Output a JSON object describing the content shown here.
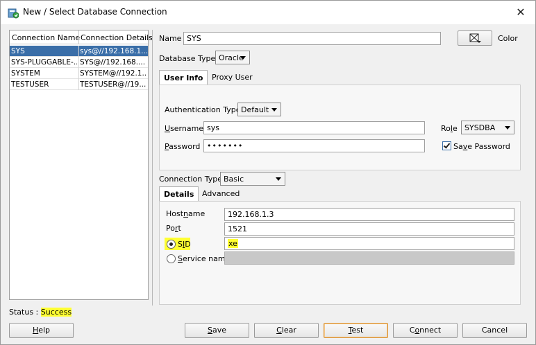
{
  "window": {
    "title": "New / Select Database Connection",
    "close_glyph": "✕"
  },
  "connections": {
    "columns": [
      "Connection Name",
      "Connection Details"
    ],
    "rows": [
      {
        "name": "SYS",
        "details": "sys@//192.168.1...",
        "selected": true
      },
      {
        "name": "SYS-PLUGGABLE-...",
        "details": "SYS@//192.168....",
        "selected": false
      },
      {
        "name": "SYSTEM",
        "details": "SYSTEM@//192.1...",
        "selected": false
      },
      {
        "name": "TESTUSER",
        "details": "TESTUSER@//19...",
        "selected": false
      }
    ]
  },
  "form": {
    "name_label": "Name",
    "name_value": "SYS",
    "color_label": "Color",
    "db_type_label": "Database Type",
    "db_type_value": "Oracle",
    "tabs": [
      "User Info",
      "Proxy User"
    ],
    "auth_type_label": "Authentication Type",
    "auth_type_value": "Default",
    "username_label_pre": "",
    "username_label_u": "U",
    "username_label_post": "sername",
    "username_value": "sys",
    "role_label_pre": "Ro",
    "role_label_u": "l",
    "role_label_post": "e",
    "role_value": "SYSDBA",
    "password_label_pre": "",
    "password_label_u": "P",
    "password_label_post": "assword",
    "password_value": "•••••••",
    "save_password_label_pre": "Sa",
    "save_password_label_u": "v",
    "save_password_label_post": "e Password",
    "save_password_checked": true,
    "conn_type_label": "Connection Type",
    "conn_type_value": "Basic",
    "detail_tabs": [
      "Details",
      "Advanced"
    ],
    "hostname_label_pre": "Host",
    "hostname_label_u": "n",
    "hostname_label_post": "ame",
    "hostname_value": "192.168.1.3",
    "port_label_pre": "Po",
    "port_label_u": "r",
    "port_label_post": "t",
    "port_value": "1521",
    "sid_label_pre": "S",
    "sid_label_u": "I",
    "sid_label_post": "D",
    "sid_value": "xe",
    "service_label_pre": "",
    "service_label_u": "S",
    "service_label_post": "ervice name",
    "service_value": ""
  },
  "status": {
    "label": "Status : ",
    "value": "Success"
  },
  "buttons": {
    "help": {
      "pre": "",
      "u": "H",
      "post": "elp"
    },
    "save": {
      "pre": "",
      "u": "S",
      "post": "ave"
    },
    "clear": {
      "pre": "",
      "u": "C",
      "post": "lear"
    },
    "test": {
      "pre": "",
      "u": "T",
      "post": "est"
    },
    "connect": {
      "pre": "C",
      "u": "o",
      "post": "nnect"
    },
    "cancel": {
      "pre": "Cancel",
      "u": "",
      "post": ""
    }
  },
  "colors": {
    "selection": "#3a6ea8",
    "highlight": "#ffff33",
    "focus_border": "#d9943a"
  }
}
